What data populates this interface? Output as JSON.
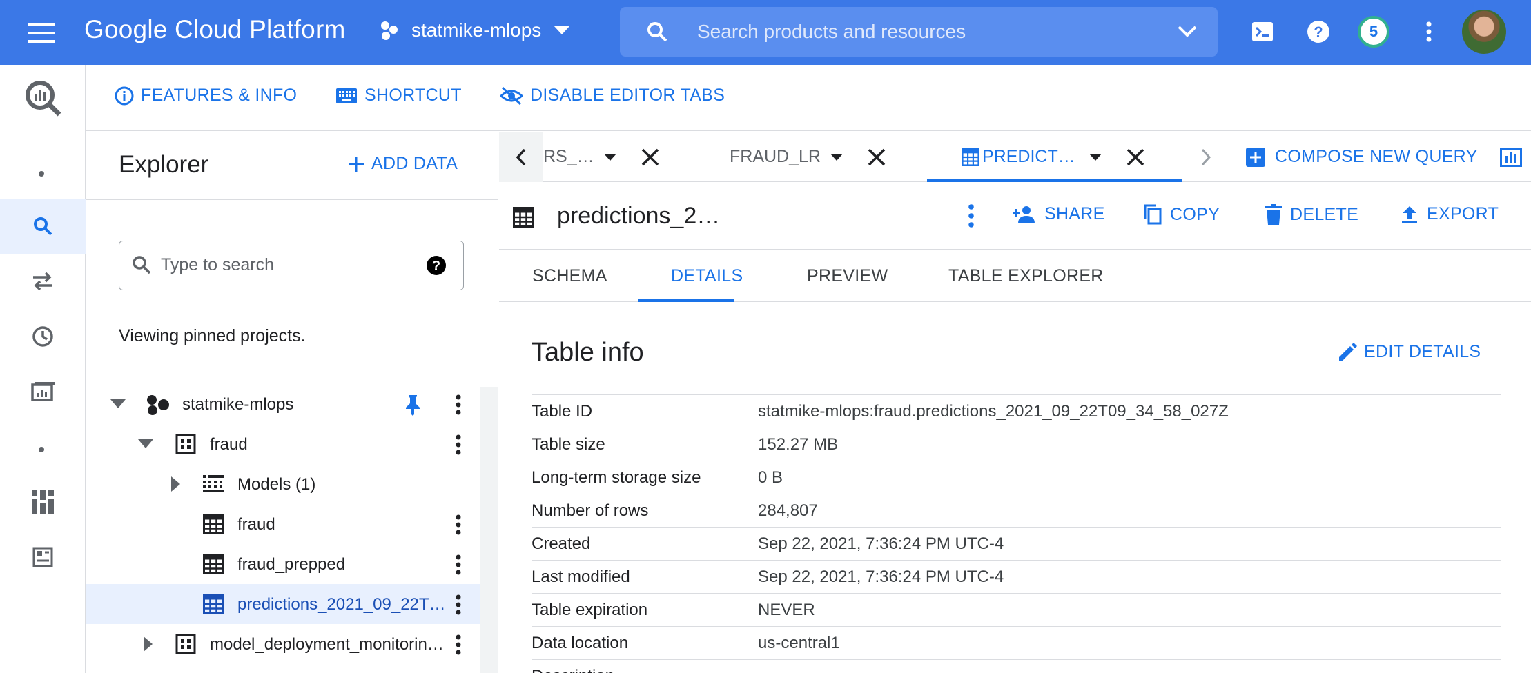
{
  "header": {
    "brand": "Google Cloud Platform",
    "project": "statmike-mlops",
    "search_placeholder": "Search products and resources",
    "notifications_count": "5",
    "icons": [
      "menu-icon",
      "project-dots-icon",
      "dropdown-icon",
      "search-icon",
      "chevron-down-icon",
      "cloud-shell-icon",
      "help-icon",
      "more-vert-icon",
      "avatar"
    ]
  },
  "rail": {
    "items": [
      "bigquery-logo-icon",
      "search-icon",
      "transfers-icon",
      "history-icon",
      "scheduled-queries-icon",
      "analytics-hub-icon",
      "dataplex-icon"
    ]
  },
  "toolbar": {
    "features": "FEATURES & INFO",
    "shortcut": "SHORTCUT",
    "disable_tabs": "DISABLE EDITOR TABS"
  },
  "explorer": {
    "title": "Explorer",
    "add_data": "ADD DATA",
    "search_placeholder": "Type to search",
    "viewing": "Viewing pinned projects.",
    "tree": {
      "project": "statmike-mlops",
      "dataset": "fraud",
      "models": "Models (1)",
      "table1": "fraud",
      "table2": "fraud_prepped",
      "table3": "predictions_2021_09_22T…",
      "dataset2": "model_deployment_monitorin…"
    }
  },
  "tabs": {
    "tab1": "RS_…",
    "tab2": "FRAUD_LR",
    "tab3": "PREDICT…",
    "compose": "COMPOSE NEW QUERY"
  },
  "detail": {
    "title": "predictions_2…",
    "share": "SHARE",
    "copy": "COPY",
    "delete": "DELETE",
    "export": "EXPORT"
  },
  "subtabs": {
    "schema": "SCHEMA",
    "details": "DETAILS",
    "preview": "PREVIEW",
    "explorer": "TABLE EXPLORER",
    "active": "DETAILS"
  },
  "info": {
    "title": "Table info",
    "edit": "EDIT DETAILS",
    "rows": [
      {
        "key": "Table ID",
        "value": "statmike-mlops:fraud.predictions_2021_09_22T09_34_58_027Z"
      },
      {
        "key": "Table size",
        "value": "152.27 MB"
      },
      {
        "key": "Long-term storage size",
        "value": "0 B"
      },
      {
        "key": "Number of rows",
        "value": "284,807"
      },
      {
        "key": "Created",
        "value": "Sep 22, 2021, 7:36:24 PM UTC-4"
      },
      {
        "key": "Last modified",
        "value": "Sep 22, 2021, 7:36:24 PM UTC-4"
      },
      {
        "key": "Table expiration",
        "value": "NEVER"
      },
      {
        "key": "Data location",
        "value": "us-central1"
      },
      {
        "key": "Description",
        "value": ""
      }
    ]
  },
  "colors": {
    "brand_bar": "#3b78e7",
    "accent": "#1a73e8",
    "selected_row": "#e8f0fe"
  }
}
